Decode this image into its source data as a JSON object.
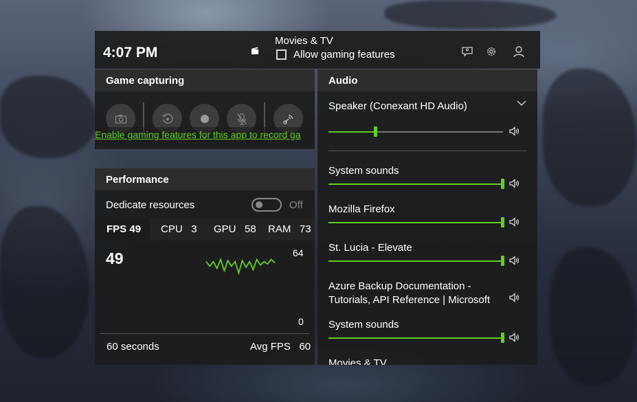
{
  "header": {
    "time": "4:07 PM",
    "app_name": "Movies & TV",
    "allow_label": "Allow gaming features",
    "icons": [
      "feedback-icon",
      "gear-icon",
      "user-icon"
    ]
  },
  "capture": {
    "title": "Game capturing",
    "buttons": [
      "camera-icon",
      "record-last-icon",
      "record-icon",
      "mic-off-icon",
      "broadcast-icon"
    ],
    "link": "Enable gaming features for this app to record ga"
  },
  "performance": {
    "title": "Performance",
    "dedicate_label": "Dedicate resources",
    "dedicate_state": "Off",
    "fps_label": "FPS",
    "fps_value": "49",
    "cpu_label": "CPU",
    "cpu_value": "3",
    "gpu_label": "GPU",
    "gpu_value": "58",
    "ram_label": "RAM",
    "ram_value": "73",
    "current": "49",
    "axis_max": "64",
    "axis_min": "0",
    "window_label": "60 seconds",
    "avg_label": "Avg FPS",
    "avg_value": "60",
    "graph_values": [
      46,
      42,
      46,
      40,
      48,
      38,
      47,
      42,
      46,
      36,
      47,
      41,
      46,
      39,
      48,
      43,
      46,
      44,
      48,
      45
    ]
  },
  "audio": {
    "title": "Audio",
    "device": "Speaker (Conexant HD Audio)",
    "device_volume": 0.27,
    "apps": [
      {
        "name": "System sounds",
        "volume": 1.0
      },
      {
        "name": "Mozilla Firefox",
        "volume": 1.0
      },
      {
        "name": "St. Lucia - Elevate",
        "volume": 1.0
      },
      {
        "name": "Azure Backup Documentation - Tutorials, API Reference | Microsoft Docs - Google Chrome",
        "volume": null
      },
      {
        "name": "System sounds",
        "volume": 1.0
      },
      {
        "name": "Movies & TV",
        "volume": null
      }
    ]
  },
  "colors": {
    "accent": "#5fd01e",
    "panel": "#1c1c1c",
    "panel_title": "#2d2d2d"
  }
}
